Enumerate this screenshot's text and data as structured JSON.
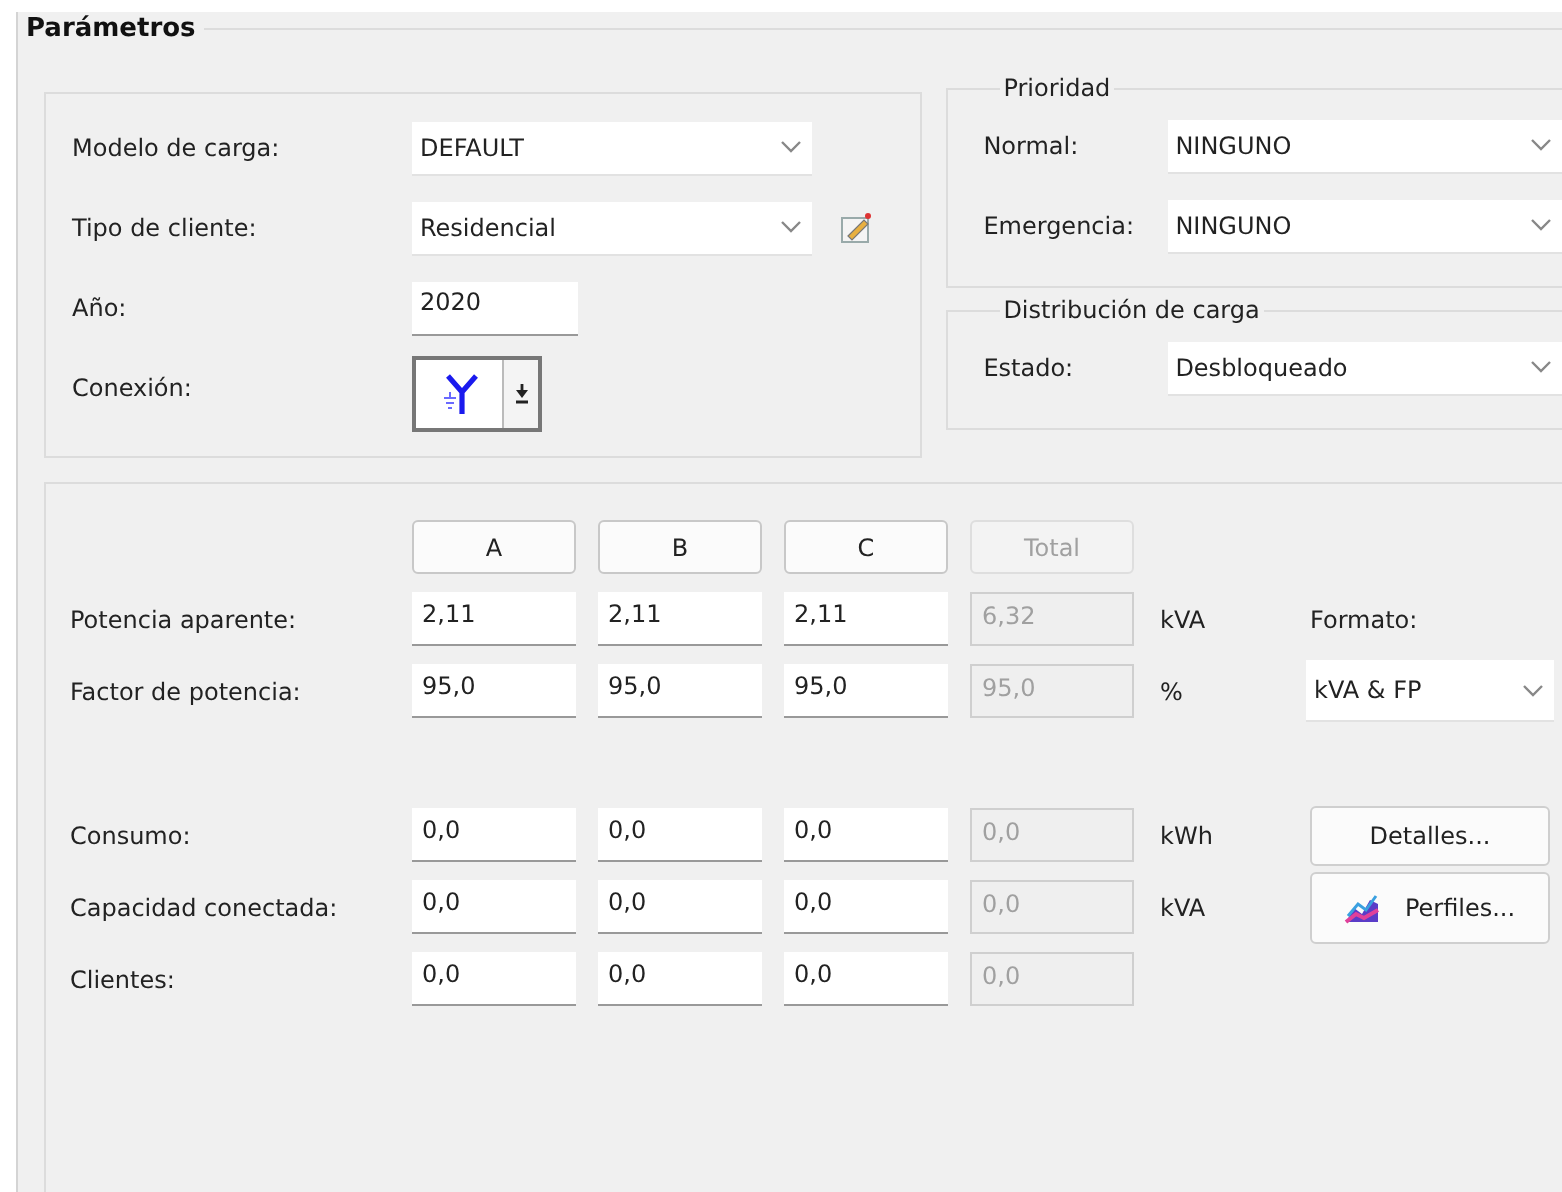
{
  "title": "Parámetros",
  "load": {
    "fields": [
      {
        "kind": "combo",
        "label": "Modelo de carga:",
        "value": "DEFAULT",
        "edit_button": false
      },
      {
        "kind": "combo",
        "label": "Tipo de cliente:",
        "value": "Residencial",
        "edit_button": true
      },
      {
        "kind": "text",
        "label": "Año:",
        "value": "2020"
      },
      {
        "kind": "connection",
        "label": "Conexión:"
      }
    ]
  },
  "priority": {
    "title": "Prioridad",
    "fields": [
      {
        "label": "Normal:",
        "value": "NINGUNO"
      },
      {
        "label": "Emergencia:",
        "value": "NINGUNO"
      }
    ]
  },
  "distribution": {
    "title": "Distribución de carga",
    "fields": [
      {
        "label": "Estado:",
        "value": "Desbloqueado"
      }
    ]
  },
  "phases": {
    "columns": [
      {
        "label": "A",
        "disabled": false
      },
      {
        "label": "B",
        "disabled": false
      },
      {
        "label": "C",
        "disabled": false
      },
      {
        "label": "Total",
        "disabled": true
      }
    ],
    "row_groups": [
      [
        {
          "label": "Potencia aparente:",
          "values": [
            "2,11",
            "2,11",
            "2,11"
          ],
          "total": "6,32",
          "unit": "kVA"
        },
        {
          "label": "Factor de potencia:",
          "values": [
            "95,0",
            "95,0",
            "95,0"
          ],
          "total": "95,0",
          "unit": "%"
        }
      ],
      [
        {
          "label": "Consumo:",
          "values": [
            "0,0",
            "0,0",
            "0,0"
          ],
          "total": "0,0",
          "unit": "kWh"
        },
        {
          "label": "Capacidad conectada:",
          "values": [
            "0,0",
            "0,0",
            "0,0"
          ],
          "total": "0,0",
          "unit": "kVA"
        },
        {
          "label": "Clientes:",
          "values": [
            "0,0",
            "0,0",
            "0,0"
          ],
          "total": "0,0"
        }
      ]
    ]
  },
  "format": {
    "label": "Formato:",
    "value": "kVA & FP"
  },
  "buttons": [
    {
      "kind": "details",
      "label": "Detalles..."
    },
    {
      "kind": "profiles",
      "label": "Perfiles..."
    }
  ]
}
